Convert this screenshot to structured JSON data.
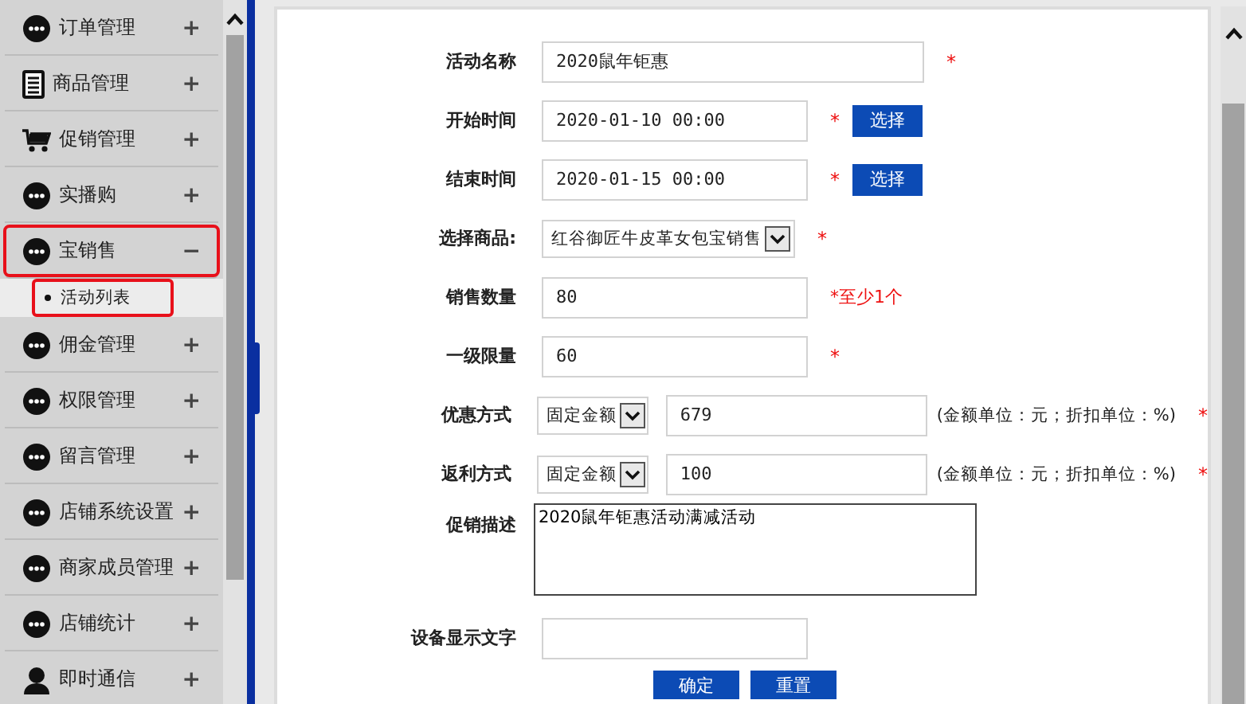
{
  "sidebar": {
    "items": [
      {
        "label": "订单管理",
        "kind": "dots",
        "highlighted": false,
        "toggle": "+"
      },
      {
        "label": "商品管理",
        "kind": "doc",
        "highlighted": false,
        "toggle": "+"
      },
      {
        "label": "促销管理",
        "kind": "cart",
        "highlighted": false,
        "toggle": "+"
      },
      {
        "label": "实播购",
        "kind": "dots",
        "highlighted": false,
        "toggle": "+"
      },
      {
        "label": "宝销售",
        "kind": "dots",
        "highlighted": true,
        "toggle": "−",
        "children": [
          {
            "label": "活动列表",
            "highlighted": true
          }
        ]
      },
      {
        "label": "佣金管理",
        "kind": "dots",
        "highlighted": false,
        "toggle": "+"
      },
      {
        "label": "权限管理",
        "kind": "dots",
        "highlighted": false,
        "toggle": "+"
      },
      {
        "label": "留言管理",
        "kind": "dots",
        "highlighted": false,
        "toggle": "+"
      },
      {
        "label": "店铺系统设置",
        "kind": "dots",
        "highlighted": false,
        "toggle": "+"
      },
      {
        "label": "商家成员管理",
        "kind": "dots",
        "highlighted": false,
        "toggle": "+"
      },
      {
        "label": "店铺统计",
        "kind": "dots",
        "highlighted": false,
        "toggle": "+"
      },
      {
        "label": "即时通信",
        "kind": "person",
        "highlighted": false,
        "toggle": "+"
      }
    ]
  },
  "form": {
    "rows": [
      {
        "kind": "wide",
        "label": "活动名称",
        "value": "2020鼠年钜惠",
        "mark": "*"
      },
      {
        "kind": "date",
        "label": "开始时间",
        "value": "2020-01-10 00:00",
        "mark": "*",
        "button": "选择"
      },
      {
        "kind": "date",
        "label": "结束时间",
        "value": "2020-01-15 00:00",
        "mark": "*",
        "button": "选择"
      },
      {
        "kind": "select",
        "label": "选择商品:",
        "value": "红谷御匠牛皮革女包宝销售",
        "mark": "*"
      },
      {
        "kind": "text",
        "label": "销售数量",
        "value": "80",
        "hint": "*至少1个"
      },
      {
        "kind": "text",
        "label": "一级限量",
        "value": "60",
        "mark": "*"
      },
      {
        "kind": "combo",
        "label": "优惠方式",
        "option": "固定金额",
        "value": "679",
        "note": "(金额单位：元；折扣单位：%)",
        "mark": "*"
      },
      {
        "kind": "combo",
        "label": "返利方式",
        "option": "固定金额",
        "value": "100",
        "note": "(金额单位：元；折扣单位：%)",
        "mark": "*"
      },
      {
        "kind": "textarea",
        "label": "促销描述",
        "value": "2020鼠年钜惠活动满减活动"
      },
      {
        "kind": "text",
        "label": "设备显示文字",
        "value": ""
      }
    ],
    "buttons": [
      "确定",
      "重置"
    ]
  }
}
